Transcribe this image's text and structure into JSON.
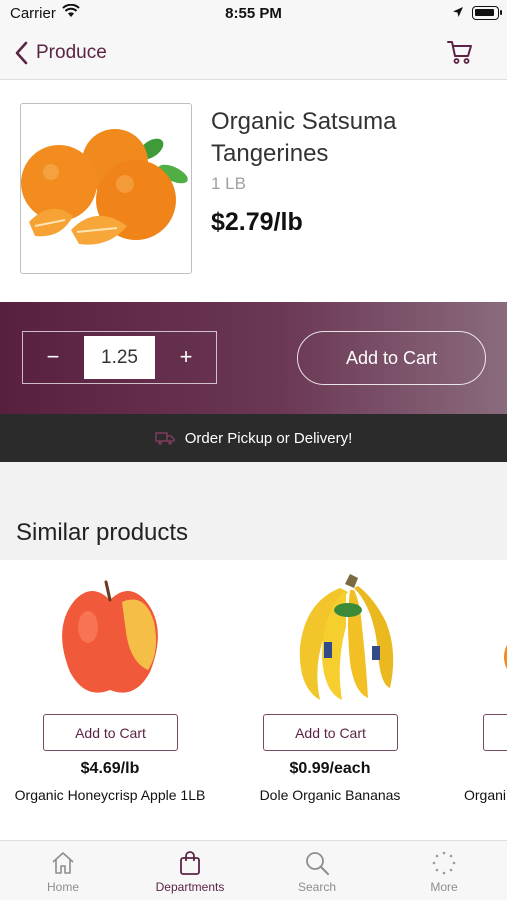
{
  "status": {
    "carrier": "Carrier",
    "time": "8:55 PM"
  },
  "nav": {
    "back_label": "Produce"
  },
  "product": {
    "name": "Organic Satsuma Tangerines",
    "size": "1 LB",
    "price": "$2.79/lb"
  },
  "buy": {
    "minus": "−",
    "quantity": "1.25",
    "plus": "+",
    "add_label": "Add to Cart"
  },
  "banner": {
    "text": "Order Pickup or Delivery!"
  },
  "similar": {
    "title": "Similar products",
    "items": [
      {
        "button": "Add to Cart",
        "price": "$4.69/lb",
        "name": "Organic Honeycrisp Apple 1LB"
      },
      {
        "button": "Add to Cart",
        "price": "$0.99/each",
        "name": "Dole Organic Bananas"
      },
      {
        "button": "",
        "price": "",
        "name": "Organi"
      }
    ]
  },
  "tabs": [
    {
      "label": "Home",
      "icon": "home-icon"
    },
    {
      "label": "Departments",
      "icon": "bag-icon"
    },
    {
      "label": "Search",
      "icon": "search-icon"
    },
    {
      "label": "More",
      "icon": "more-icon"
    }
  ],
  "colors": {
    "brand": "#5b2445",
    "banner": "#2b2b2b"
  }
}
